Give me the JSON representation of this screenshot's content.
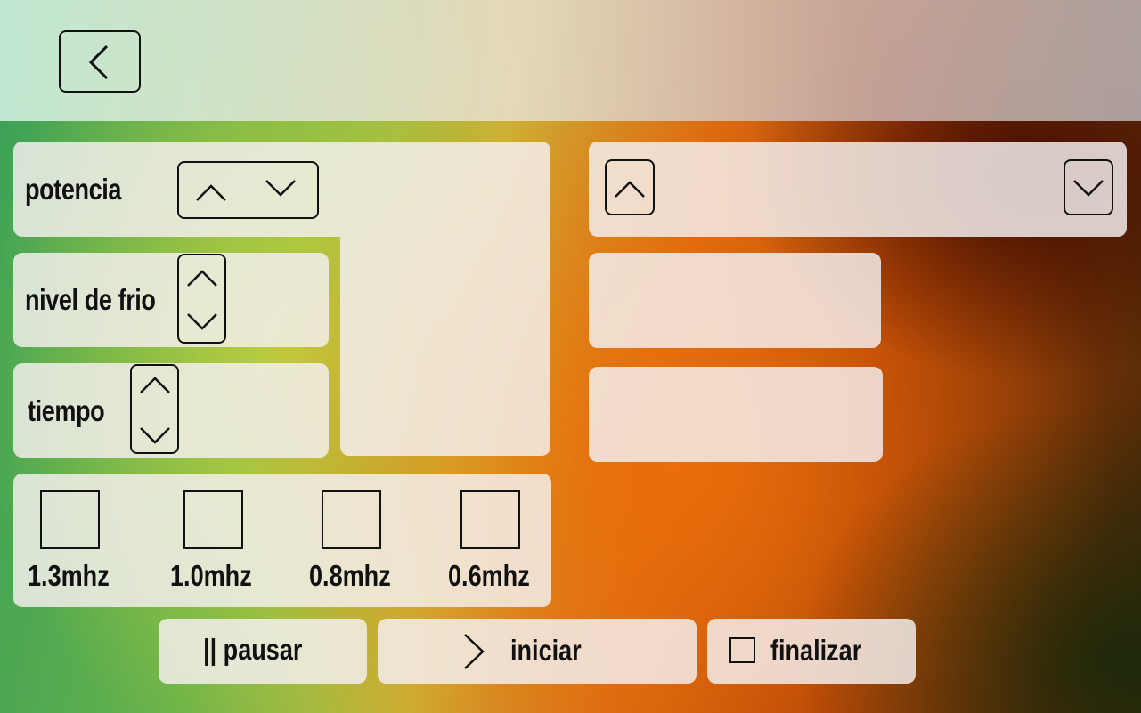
{
  "header": {
    "back_icon": "chevron-left-icon"
  },
  "controls": {
    "potencia_label": "potencia",
    "nivel_frio_label": "nivel de frio",
    "tiempo_label": "tiempo"
  },
  "frequencies": [
    {
      "label": "1.3mhz",
      "checked": false
    },
    {
      "label": "1.0mhz",
      "checked": false
    },
    {
      "label": "0.8mhz",
      "checked": false
    },
    {
      "label": "0.6mhz",
      "checked": false
    }
  ],
  "actions": {
    "pause_label": "|| pausar",
    "start_label": "iniciar",
    "finish_label": "finalizar"
  },
  "colors": {
    "panel": "#f4f0ee",
    "stroke": "#111111"
  }
}
